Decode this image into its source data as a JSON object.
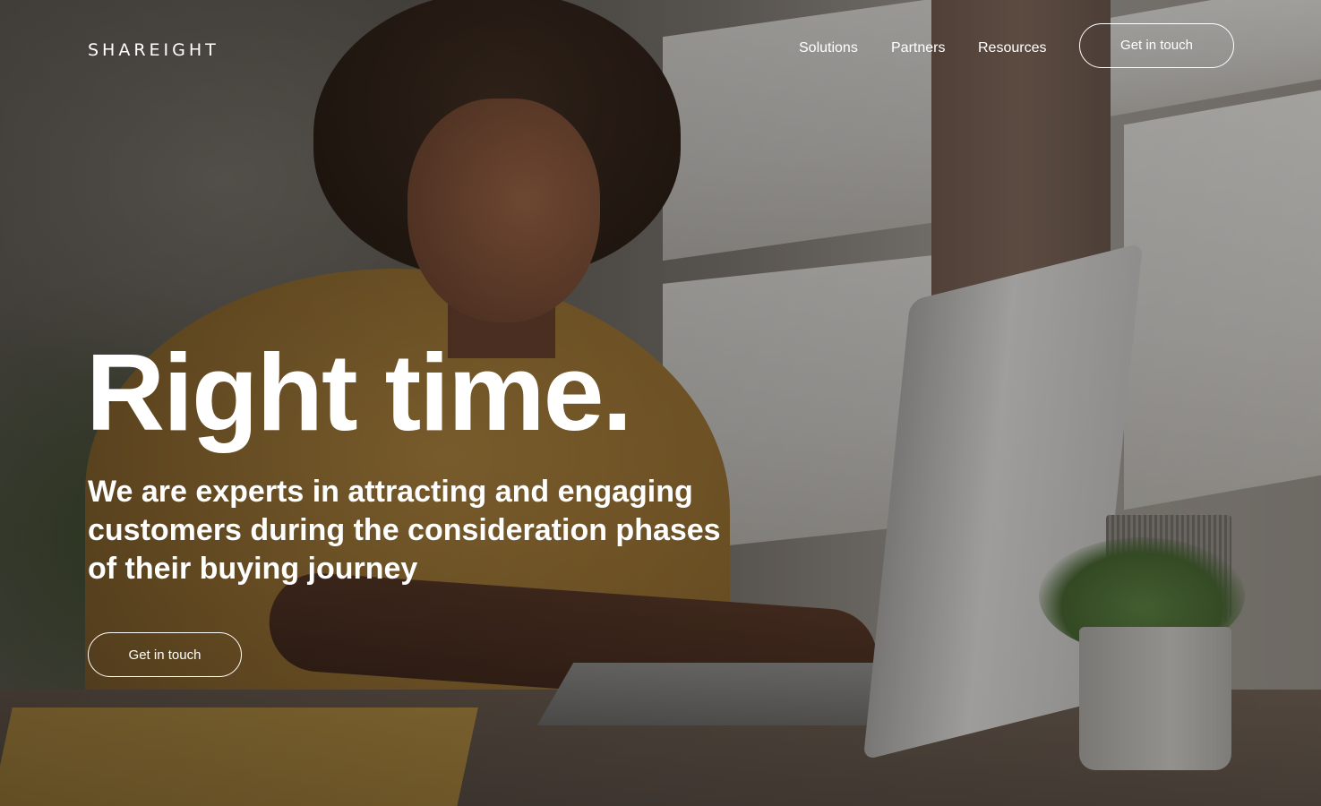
{
  "header": {
    "logo": "SHAREIGHT",
    "nav": [
      {
        "label": "Solutions"
      },
      {
        "label": "Partners"
      },
      {
        "label": "Resources"
      }
    ],
    "cta_label": "Get in touch"
  },
  "hero": {
    "headline": "Right time.",
    "subheadline": "We are experts in attracting and engaging customers during the consideration phases of their buying journey",
    "cta_label": "Get in touch",
    "background_image": "woman-smiling-typing-on-laptop-at-desk"
  },
  "colors": {
    "text": "#ffffff",
    "button_border": "#ffffff"
  }
}
